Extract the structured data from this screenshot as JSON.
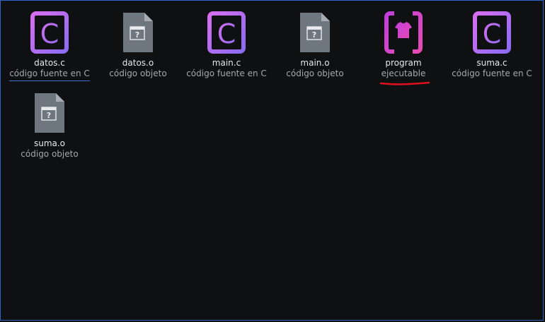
{
  "colors": {
    "background": "#0f1012",
    "frame_border": "#2f66c4",
    "c_icon_gradient_start": "#d06df0",
    "c_icon_gradient_end": "#8b6cf2",
    "exe_icon_gradient_start": "#c93fd8",
    "exe_icon_gradient_end": "#e048b8",
    "object_icon": "#6e7680",
    "annotation_red": "#e0101e"
  },
  "files": [
    {
      "name": "datos.c",
      "type": "código fuente en C",
      "icon": "c-source-icon"
    },
    {
      "name": "datos.o",
      "type": "código objeto",
      "icon": "object-file-icon"
    },
    {
      "name": "main.c",
      "type": "código fuente en C",
      "icon": "c-source-icon"
    },
    {
      "name": "main.o",
      "type": "código objeto",
      "icon": "object-file-icon"
    },
    {
      "name": "program",
      "type": "ejecutable",
      "icon": "executable-icon"
    },
    {
      "name": "suma.c",
      "type": "código fuente en C",
      "icon": "c-source-icon"
    },
    {
      "name": "suma.o",
      "type": "código objeto",
      "icon": "object-file-icon"
    }
  ],
  "icon_glyphs": {
    "c_letter": "C",
    "object_question": "?"
  }
}
